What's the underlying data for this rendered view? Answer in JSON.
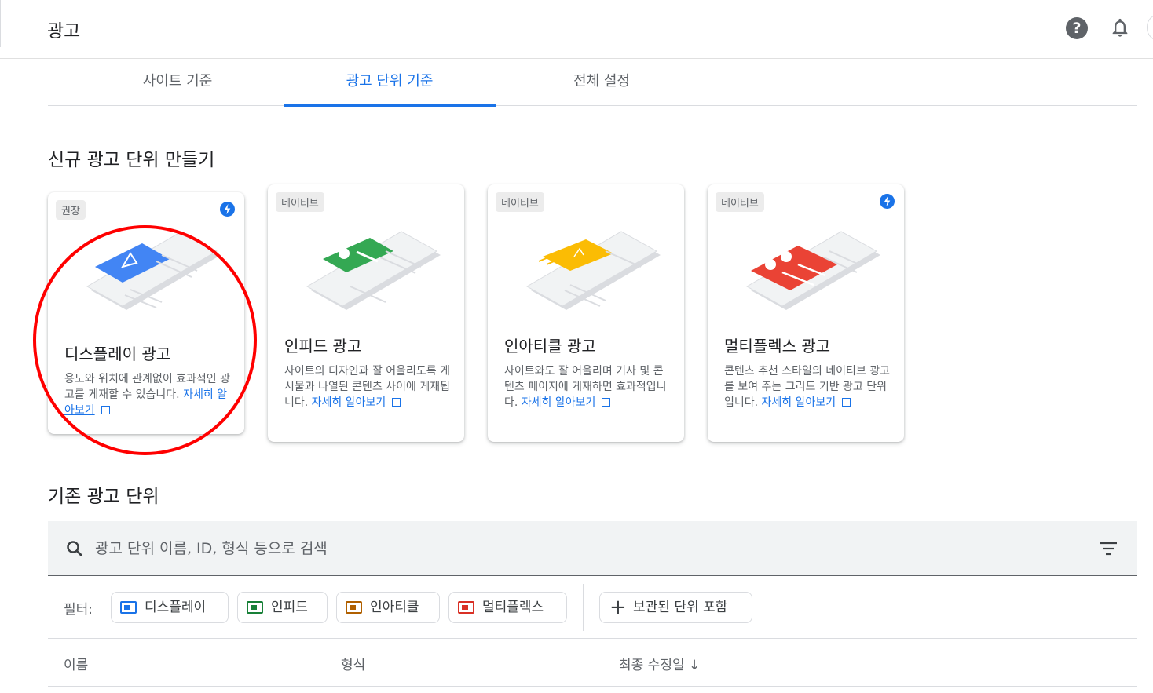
{
  "header": {
    "title": "광고"
  },
  "tabs": [
    {
      "label": "사이트 기준",
      "active": false
    },
    {
      "label": "광고 단위 기준",
      "active": true
    },
    {
      "label": "전체 설정",
      "active": false
    }
  ],
  "new_section": {
    "title": "신규 광고 단위 만들기",
    "cards": [
      {
        "chip": "권장",
        "title": "디스플레이 광고",
        "desc": "용도와 위치에 관계없이 효과적인 광고를 게재할 수 있습니다.",
        "link": "자세히 알아보기",
        "bolt_icon": "bolt-icon",
        "accent": "#4285f4"
      },
      {
        "chip": "네이티브",
        "title": "인피드 광고",
        "desc": "사이트의 디자인과 잘 어울리도록 게시물과 나열된 콘텐츠 사이에 게재됩니다.",
        "link": "자세히 알아보기",
        "accent": "#34a853"
      },
      {
        "chip": "네이티브",
        "title": "인아티클 광고",
        "desc": "사이트와도 잘 어울리며 기사 및 콘텐츠 페이지에 게재하면 효과적입니다.",
        "link": "자세히 알아보기",
        "accent": "#fbbc04"
      },
      {
        "chip": "네이티브",
        "title": "멀티플렉스 광고",
        "desc": "콘텐츠 추천 스타일의 네이티브 광고를 보여 주는 그리드 기반 광고 단위입니다.",
        "link": "자세히 알아보기",
        "bolt_icon": "bolt-icon",
        "accent": "#ea4335"
      }
    ]
  },
  "existing_section": {
    "title": "기존 광고 단위",
    "search": {
      "placeholder": "광고 단위 이름, ID, 형식 등으로 검색",
      "value": ""
    },
    "filter": {
      "label": "필터:",
      "chips": [
        {
          "label": "디스플레이",
          "color": "#1a73e8"
        },
        {
          "label": "인피드",
          "color": "#188038"
        },
        {
          "label": "인아티클",
          "color": "#b06000"
        },
        {
          "label": "멀티플렉스",
          "color": "#d93025"
        }
      ],
      "archived_button": "보관된 단위 포함"
    },
    "table_headers": {
      "name": "이름",
      "format": "형식",
      "last_modified": "최종 수정일 ↓"
    }
  },
  "colors": {
    "accent": "#1a73e8",
    "highlight_circle": "#ff0000"
  }
}
